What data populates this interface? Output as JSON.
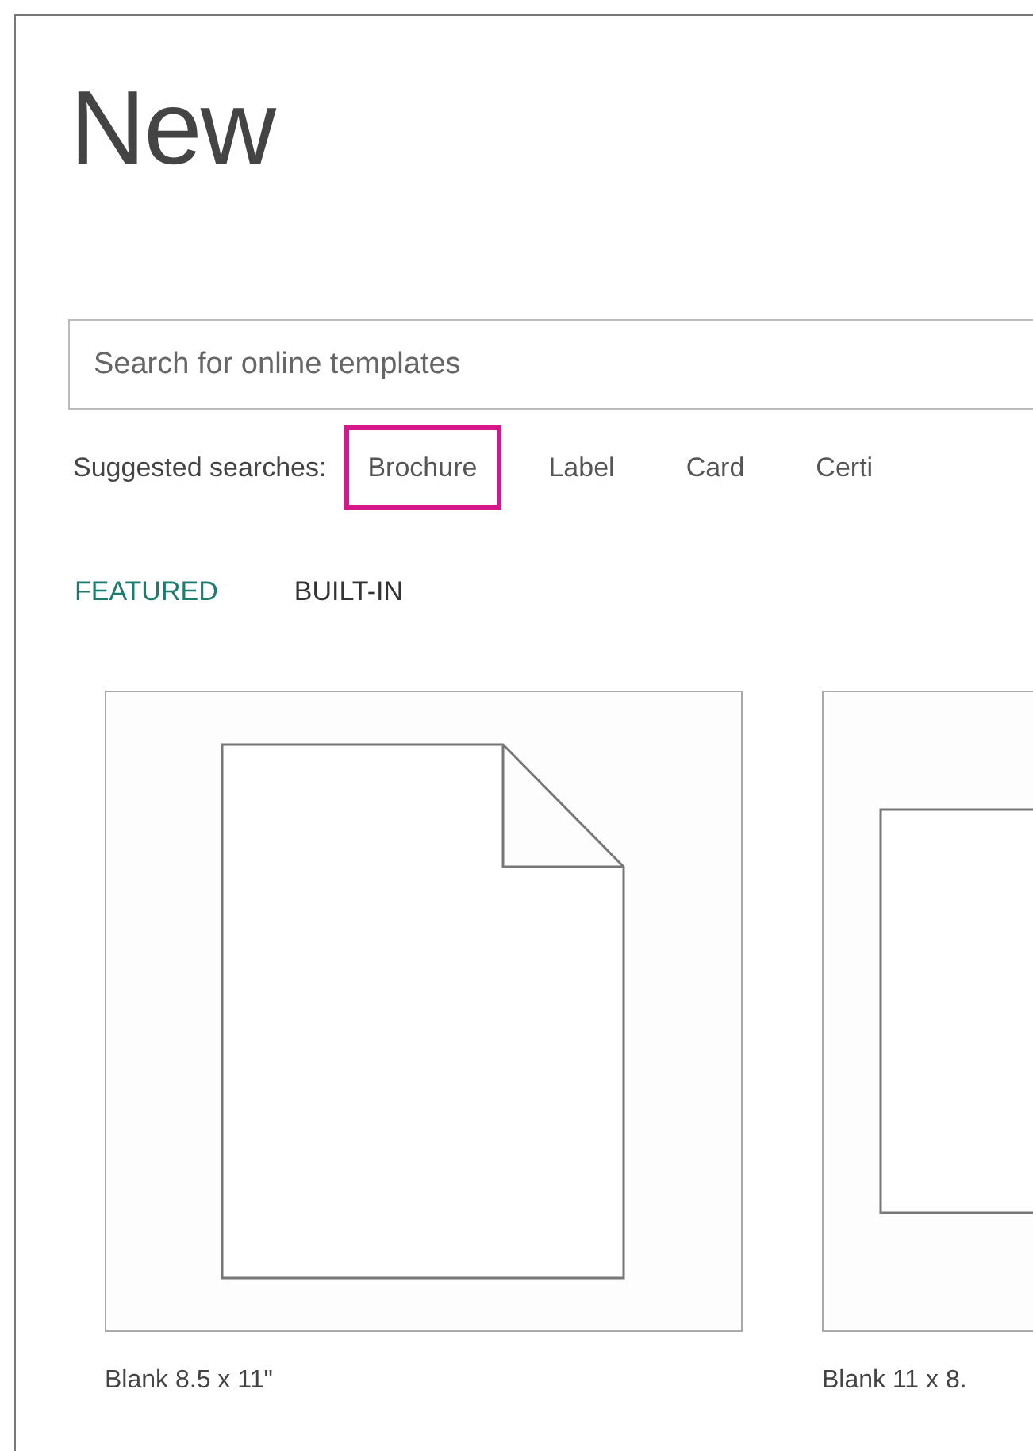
{
  "title": "New",
  "search": {
    "placeholder": "Search for online templates"
  },
  "suggested": {
    "label": "Suggested searches:",
    "items": [
      {
        "text": "Brochure",
        "highlighted": true
      },
      {
        "text": "Label",
        "highlighted": false
      },
      {
        "text": "Card",
        "highlighted": false
      },
      {
        "text": "Certi",
        "highlighted": false
      }
    ]
  },
  "tabs": [
    {
      "label": "FEATURED",
      "selected": true
    },
    {
      "label": "BUILT-IN",
      "selected": false
    }
  ],
  "templates": [
    {
      "name": "Blank 8.5 x 11\"",
      "kind": "portrait"
    },
    {
      "name": "Blank 11 x 8.",
      "kind": "landscape"
    }
  ]
}
